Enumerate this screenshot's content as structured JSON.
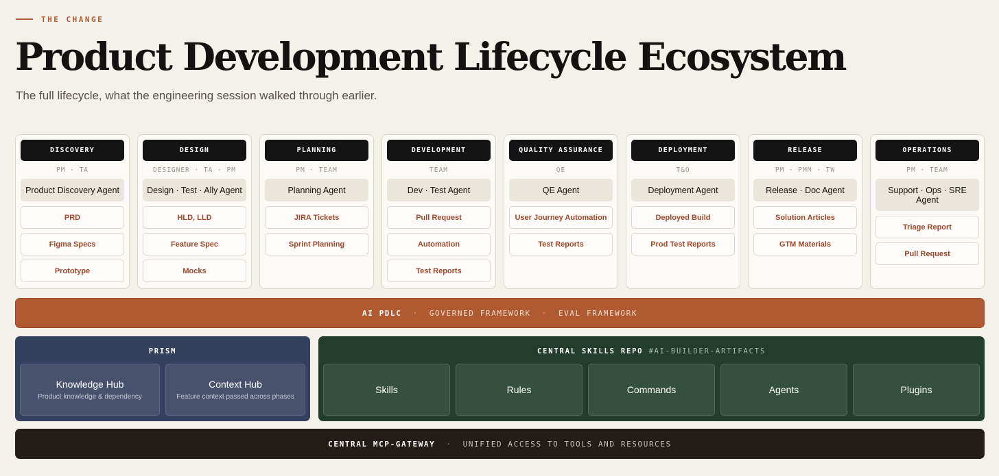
{
  "header": {
    "eyebrow": "THE CHANGE",
    "title": "Product Development Lifecycle Ecosystem",
    "subtitle": "The full lifecycle, what the engineering session walked through earlier."
  },
  "phases": [
    {
      "name": "DISCOVERY",
      "roles": "PM · TA",
      "agent": "Product Discovery Agent",
      "artifacts": [
        "PRD",
        "Figma Specs",
        "Prototype"
      ]
    },
    {
      "name": "DESIGN",
      "roles": "DESIGNER · TA · PM",
      "agent": "Design · Test · Ally Agent",
      "artifacts": [
        "HLD, LLD",
        "Feature Spec",
        "Mocks"
      ]
    },
    {
      "name": "PLANNING",
      "roles": "PM · TEAM",
      "agent": "Planning Agent",
      "artifacts": [
        "JIRA Tickets",
        "Sprint Planning"
      ]
    },
    {
      "name": "DEVELOPMENT",
      "roles": "TEAM",
      "agent": "Dev · Test Agent",
      "artifacts": [
        "Pull Request",
        "Automation",
        "Test Reports"
      ]
    },
    {
      "name": "QUALITY ASSURANCE",
      "roles": "QE",
      "agent": "QE Agent",
      "artifacts": [
        "User Journey Automation",
        "Test Reports"
      ]
    },
    {
      "name": "DEPLOYMENT",
      "roles": "T&O",
      "agent": "Deployment Agent",
      "artifacts": [
        "Deployed Build",
        "Prod Test Reports"
      ]
    },
    {
      "name": "RELEASE",
      "roles": "PM · PMM · TW",
      "agent": "Release · Doc Agent",
      "artifacts": [
        "Solution Articles",
        "GTM Materials"
      ]
    },
    {
      "name": "OPERATIONS",
      "roles": "PM · TEAM",
      "agent": "Support · Ops · SRE Agent",
      "artifacts": [
        "Triage Report",
        "Pull Request"
      ]
    }
  ],
  "framework_band": {
    "primary": "AI PDLC",
    "separator": "·",
    "items": [
      "GOVERNED FRAMEWORK",
      "EVAL FRAMEWORK"
    ]
  },
  "prism": {
    "title": "PRISM",
    "cards": [
      {
        "name": "Knowledge Hub",
        "desc": "Product knowledge & dependency"
      },
      {
        "name": "Context Hub",
        "desc": "Feature context passed across phases"
      }
    ]
  },
  "skills_repo": {
    "title": "CENTRAL SKILLS REPO",
    "tag": "#AI-BUILDER-ARTIFACTS",
    "cards": [
      "Skills",
      "Rules",
      "Commands",
      "Agents",
      "Plugins"
    ]
  },
  "gateway": {
    "primary": "CENTRAL MCP-GATEWAY",
    "separator": "·",
    "secondary": "UNIFIED ACCESS TO TOOLS AND RESOURCES"
  },
  "colors": {
    "accent": "#b05a31",
    "prism_bg": "#33415e",
    "skills_bg": "#223d2e",
    "gateway_bg": "#231c18"
  }
}
